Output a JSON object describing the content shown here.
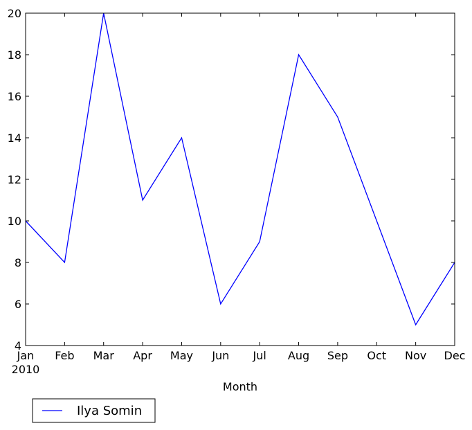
{
  "chart_data": {
    "type": "line",
    "title": "",
    "xlabel": "Month",
    "ylabel": "",
    "categories": [
      "Jan",
      "Feb",
      "Mar",
      "Apr",
      "May",
      "Jun",
      "Jul",
      "Aug",
      "Sep",
      "Oct",
      "Nov",
      "Dec"
    ],
    "x_tick_labels": [
      "Jan\n2010",
      "Feb",
      "Mar",
      "Apr",
      "May",
      "Jun",
      "Jul",
      "Aug",
      "Sep",
      "Oct",
      "Nov",
      "Dec"
    ],
    "year_label": "2010",
    "series": [
      {
        "name": "Ilya Somin",
        "color": "#0000ff",
        "values": [
          10,
          8,
          20,
          11,
          14,
          6,
          9,
          18,
          15,
          10,
          5,
          8
        ]
      }
    ],
    "ylim": [
      4,
      20
    ],
    "y_ticks": [
      4,
      6,
      8,
      10,
      12,
      14,
      16,
      18,
      20
    ],
    "grid": false,
    "legend": {
      "placement": "below-left",
      "entries": [
        "Ilya Somin"
      ]
    }
  }
}
